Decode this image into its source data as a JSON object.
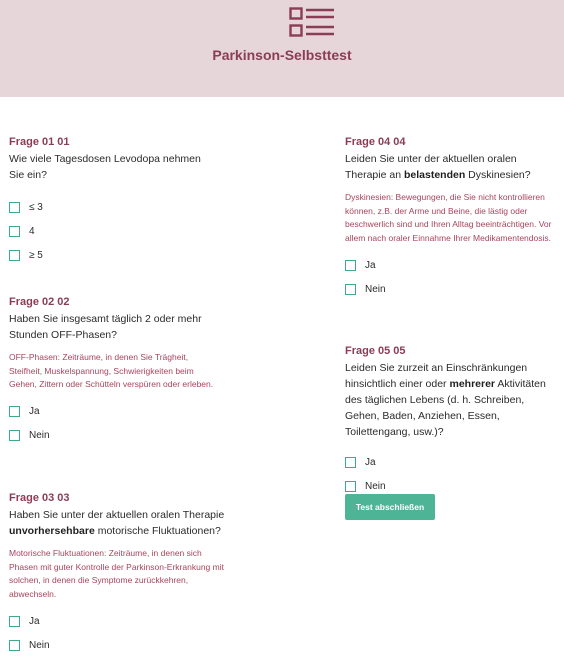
{
  "header": {
    "title": "Parkinson-Selbsttest",
    "icon": "list-form-icon",
    "color": "#8a3d55",
    "background": "#e6d6da"
  },
  "questions": [
    {
      "title": "Frage 01 01",
      "text_parts": [
        "Wie viele Tagesdosen Levodopa nehmen Sie ein?"
      ],
      "hint": "",
      "options": [
        "≤ 3",
        "4",
        "≥ 5"
      ]
    },
    {
      "title": "Frage 02 02",
      "text_parts": [
        "Haben Sie insgesamt täglich 2 oder mehr Stunden OFF-Phasen?"
      ],
      "hint": "OFF-Phasen: Zeiträume, in denen Sie Trägheit, Steifheit, Muskelspannung, Schwierigkeiten beim Gehen, Zittern oder Schütteln verspüren oder erleben.",
      "options": [
        "Ja",
        "Nein"
      ]
    },
    {
      "title": "Frage 03 03",
      "text_parts": [
        "Haben Sie unter der aktuellen oralen Therapie ",
        "unvorhersehbare",
        " motorische Fluktuationen?"
      ],
      "hint": "Motorische Fluktuationen: Zeiträume, in denen sich Phasen mit guter Kontrolle der Parkinson-Erkrankung mit solchen, in denen die Symptome zurückkehren, abwechseln.",
      "options": [
        "Ja",
        "Nein"
      ]
    },
    {
      "title": "Frage 04 04",
      "text_parts": [
        "Leiden Sie unter der aktuellen oralen Therapie an ",
        "belastenden",
        " Dyskinesien?"
      ],
      "hint": "Dyskinesien: Bewegungen, die Sie nicht kontrollieren können, z.B. der Arme und Beine, die lästig oder beschwerlich sind und Ihren Alltag beeinträchtigen. Vor allem nach oraler Einnahme Ihrer Medikamentendosis.",
      "options": [
        "Ja",
        "Nein"
      ]
    },
    {
      "title": "Frage 05 05",
      "text_parts": [
        "Leiden Sie zurzeit an Einschränkungen hinsichtlich einer oder ",
        "mehrerer",
        " Aktivitäten des täglichen Lebens (d. h. Schreiben, Gehen, Baden, Anziehen, Essen, Toilettengang, usw.)?"
      ],
      "hint": "",
      "options": [
        "Ja",
        "Nein"
      ]
    }
  ],
  "submit_label": "Test abschließen",
  "colors": {
    "accent": "#4db596",
    "question_title": "#8a3d55",
    "hint": "#a8445e"
  }
}
